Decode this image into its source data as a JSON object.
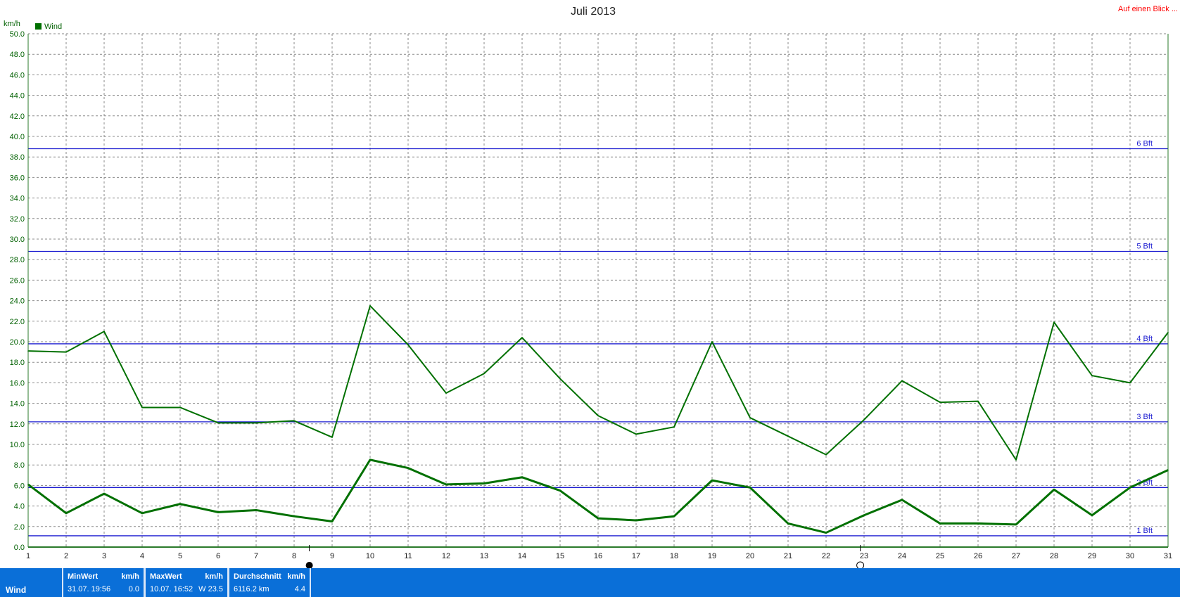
{
  "chart_data": {
    "type": "line",
    "title": "Juli 2013",
    "corner_link": "Auf einen Blick ...",
    "ylabel": "km/h",
    "xlabel": "",
    "ylim": [
      0,
      50
    ],
    "xlim": [
      1,
      31
    ],
    "yticks": [
      "0.0",
      "2.0",
      "4.0",
      "6.0",
      "8.0",
      "10.0",
      "12.0",
      "14.0",
      "16.0",
      "18.0",
      "20.0",
      "22.0",
      "24.0",
      "26.0",
      "28.0",
      "30.0",
      "32.0",
      "34.0",
      "36.0",
      "38.0",
      "40.0",
      "42.0",
      "44.0",
      "46.0",
      "48.0",
      "50.0"
    ],
    "x": [
      1,
      2,
      3,
      4,
      5,
      6,
      7,
      8,
      9,
      10,
      11,
      12,
      13,
      14,
      15,
      16,
      17,
      18,
      19,
      20,
      21,
      22,
      23,
      24,
      25,
      26,
      27,
      28,
      29,
      30,
      31
    ],
    "legend": [
      {
        "label": "Wind",
        "color": "#007000"
      }
    ],
    "legend_position": "top-left",
    "grid": true,
    "series": [
      {
        "name": "Wind",
        "line": "max",
        "color": "#007000",
        "values": [
          19.1,
          19.0,
          21.0,
          13.6,
          13.6,
          12.1,
          12.1,
          12.3,
          10.7,
          23.5,
          19.7,
          15.0,
          16.9,
          20.4,
          16.4,
          12.8,
          11.0,
          11.7,
          20.0,
          12.6,
          10.8,
          9.0,
          12.4,
          16.2,
          14.1,
          14.2,
          8.5,
          21.9,
          16.7,
          16.0,
          20.9
        ]
      },
      {
        "name": "Wind",
        "line": "avg",
        "color": "#007000",
        "values": [
          6.1,
          3.3,
          5.2,
          3.3,
          4.2,
          3.4,
          3.6,
          3.0,
          2.5,
          8.5,
          7.7,
          6.1,
          6.2,
          6.8,
          5.5,
          2.8,
          2.6,
          3.0,
          6.5,
          5.8,
          2.3,
          1.4,
          3.1,
          4.6,
          2.3,
          2.3,
          2.2,
          5.6,
          3.1,
          5.8,
          7.5
        ]
      }
    ],
    "beaufort_lines": [
      {
        "label": "1 Bft",
        "value": 1.1
      },
      {
        "label": "2 Bft",
        "value": 5.8
      },
      {
        "label": "3 Bft",
        "value": 12.2
      },
      {
        "label": "4 Bft",
        "value": 19.8
      },
      {
        "label": "5 Bft",
        "value": 28.8
      },
      {
        "label": "6 Bft",
        "value": 38.8
      }
    ],
    "moon_markers": [
      {
        "day": 8.4,
        "phase": "new-moon"
      },
      {
        "day": 22.9,
        "phase": "full-moon"
      }
    ]
  },
  "stats": {
    "row_label": "Wind",
    "min": {
      "header": "MinWert",
      "unit": "km/h",
      "when": "31.07.  19:56",
      "value": "0.0"
    },
    "max": {
      "header": "MaxWert",
      "unit": "km/h",
      "when": "10.07.  16:52",
      "value": "W 23.5"
    },
    "avg": {
      "header": "Durchschnitt",
      "unit": "km/h",
      "when": "6116.2 km",
      "value": "4.4"
    }
  }
}
